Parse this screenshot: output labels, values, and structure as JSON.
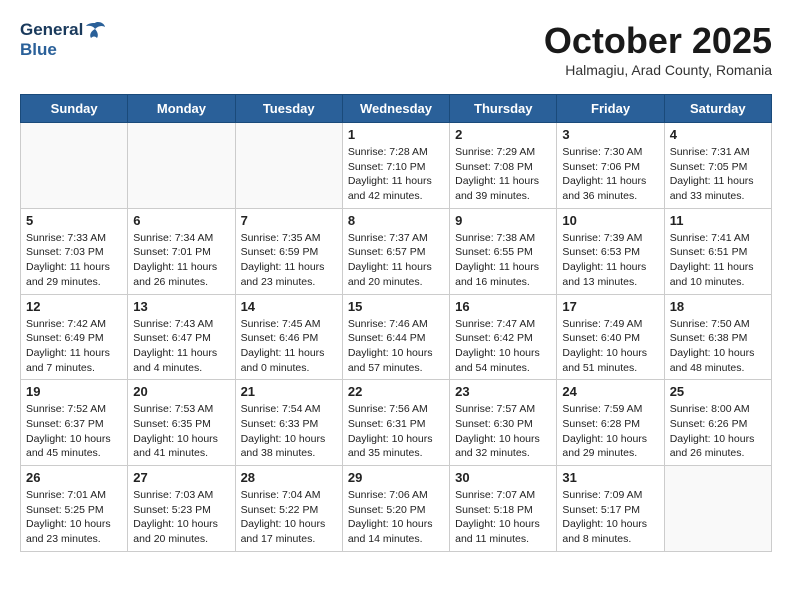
{
  "header": {
    "logo_general": "General",
    "logo_blue": "Blue",
    "month_title": "October 2025",
    "subtitle": "Halmagiu, Arad County, Romania"
  },
  "weekdays": [
    "Sunday",
    "Monday",
    "Tuesday",
    "Wednesday",
    "Thursday",
    "Friday",
    "Saturday"
  ],
  "weeks": [
    [
      {
        "day": "",
        "info": ""
      },
      {
        "day": "",
        "info": ""
      },
      {
        "day": "",
        "info": ""
      },
      {
        "day": "1",
        "info": "Sunrise: 7:28 AM\nSunset: 7:10 PM\nDaylight: 11 hours\nand 42 minutes."
      },
      {
        "day": "2",
        "info": "Sunrise: 7:29 AM\nSunset: 7:08 PM\nDaylight: 11 hours\nand 39 minutes."
      },
      {
        "day": "3",
        "info": "Sunrise: 7:30 AM\nSunset: 7:06 PM\nDaylight: 11 hours\nand 36 minutes."
      },
      {
        "day": "4",
        "info": "Sunrise: 7:31 AM\nSunset: 7:05 PM\nDaylight: 11 hours\nand 33 minutes."
      }
    ],
    [
      {
        "day": "5",
        "info": "Sunrise: 7:33 AM\nSunset: 7:03 PM\nDaylight: 11 hours\nand 29 minutes."
      },
      {
        "day": "6",
        "info": "Sunrise: 7:34 AM\nSunset: 7:01 PM\nDaylight: 11 hours\nand 26 minutes."
      },
      {
        "day": "7",
        "info": "Sunrise: 7:35 AM\nSunset: 6:59 PM\nDaylight: 11 hours\nand 23 minutes."
      },
      {
        "day": "8",
        "info": "Sunrise: 7:37 AM\nSunset: 6:57 PM\nDaylight: 11 hours\nand 20 minutes."
      },
      {
        "day": "9",
        "info": "Sunrise: 7:38 AM\nSunset: 6:55 PM\nDaylight: 11 hours\nand 16 minutes."
      },
      {
        "day": "10",
        "info": "Sunrise: 7:39 AM\nSunset: 6:53 PM\nDaylight: 11 hours\nand 13 minutes."
      },
      {
        "day": "11",
        "info": "Sunrise: 7:41 AM\nSunset: 6:51 PM\nDaylight: 11 hours\nand 10 minutes."
      }
    ],
    [
      {
        "day": "12",
        "info": "Sunrise: 7:42 AM\nSunset: 6:49 PM\nDaylight: 11 hours\nand 7 minutes."
      },
      {
        "day": "13",
        "info": "Sunrise: 7:43 AM\nSunset: 6:47 PM\nDaylight: 11 hours\nand 4 minutes."
      },
      {
        "day": "14",
        "info": "Sunrise: 7:45 AM\nSunset: 6:46 PM\nDaylight: 11 hours\nand 0 minutes."
      },
      {
        "day": "15",
        "info": "Sunrise: 7:46 AM\nSunset: 6:44 PM\nDaylight: 10 hours\nand 57 minutes."
      },
      {
        "day": "16",
        "info": "Sunrise: 7:47 AM\nSunset: 6:42 PM\nDaylight: 10 hours\nand 54 minutes."
      },
      {
        "day": "17",
        "info": "Sunrise: 7:49 AM\nSunset: 6:40 PM\nDaylight: 10 hours\nand 51 minutes."
      },
      {
        "day": "18",
        "info": "Sunrise: 7:50 AM\nSunset: 6:38 PM\nDaylight: 10 hours\nand 48 minutes."
      }
    ],
    [
      {
        "day": "19",
        "info": "Sunrise: 7:52 AM\nSunset: 6:37 PM\nDaylight: 10 hours\nand 45 minutes."
      },
      {
        "day": "20",
        "info": "Sunrise: 7:53 AM\nSunset: 6:35 PM\nDaylight: 10 hours\nand 41 minutes."
      },
      {
        "day": "21",
        "info": "Sunrise: 7:54 AM\nSunset: 6:33 PM\nDaylight: 10 hours\nand 38 minutes."
      },
      {
        "day": "22",
        "info": "Sunrise: 7:56 AM\nSunset: 6:31 PM\nDaylight: 10 hours\nand 35 minutes."
      },
      {
        "day": "23",
        "info": "Sunrise: 7:57 AM\nSunset: 6:30 PM\nDaylight: 10 hours\nand 32 minutes."
      },
      {
        "day": "24",
        "info": "Sunrise: 7:59 AM\nSunset: 6:28 PM\nDaylight: 10 hours\nand 29 minutes."
      },
      {
        "day": "25",
        "info": "Sunrise: 8:00 AM\nSunset: 6:26 PM\nDaylight: 10 hours\nand 26 minutes."
      }
    ],
    [
      {
        "day": "26",
        "info": "Sunrise: 7:01 AM\nSunset: 5:25 PM\nDaylight: 10 hours\nand 23 minutes."
      },
      {
        "day": "27",
        "info": "Sunrise: 7:03 AM\nSunset: 5:23 PM\nDaylight: 10 hours\nand 20 minutes."
      },
      {
        "day": "28",
        "info": "Sunrise: 7:04 AM\nSunset: 5:22 PM\nDaylight: 10 hours\nand 17 minutes."
      },
      {
        "day": "29",
        "info": "Sunrise: 7:06 AM\nSunset: 5:20 PM\nDaylight: 10 hours\nand 14 minutes."
      },
      {
        "day": "30",
        "info": "Sunrise: 7:07 AM\nSunset: 5:18 PM\nDaylight: 10 hours\nand 11 minutes."
      },
      {
        "day": "31",
        "info": "Sunrise: 7:09 AM\nSunset: 5:17 PM\nDaylight: 10 hours\nand 8 minutes."
      },
      {
        "day": "",
        "info": ""
      }
    ]
  ]
}
